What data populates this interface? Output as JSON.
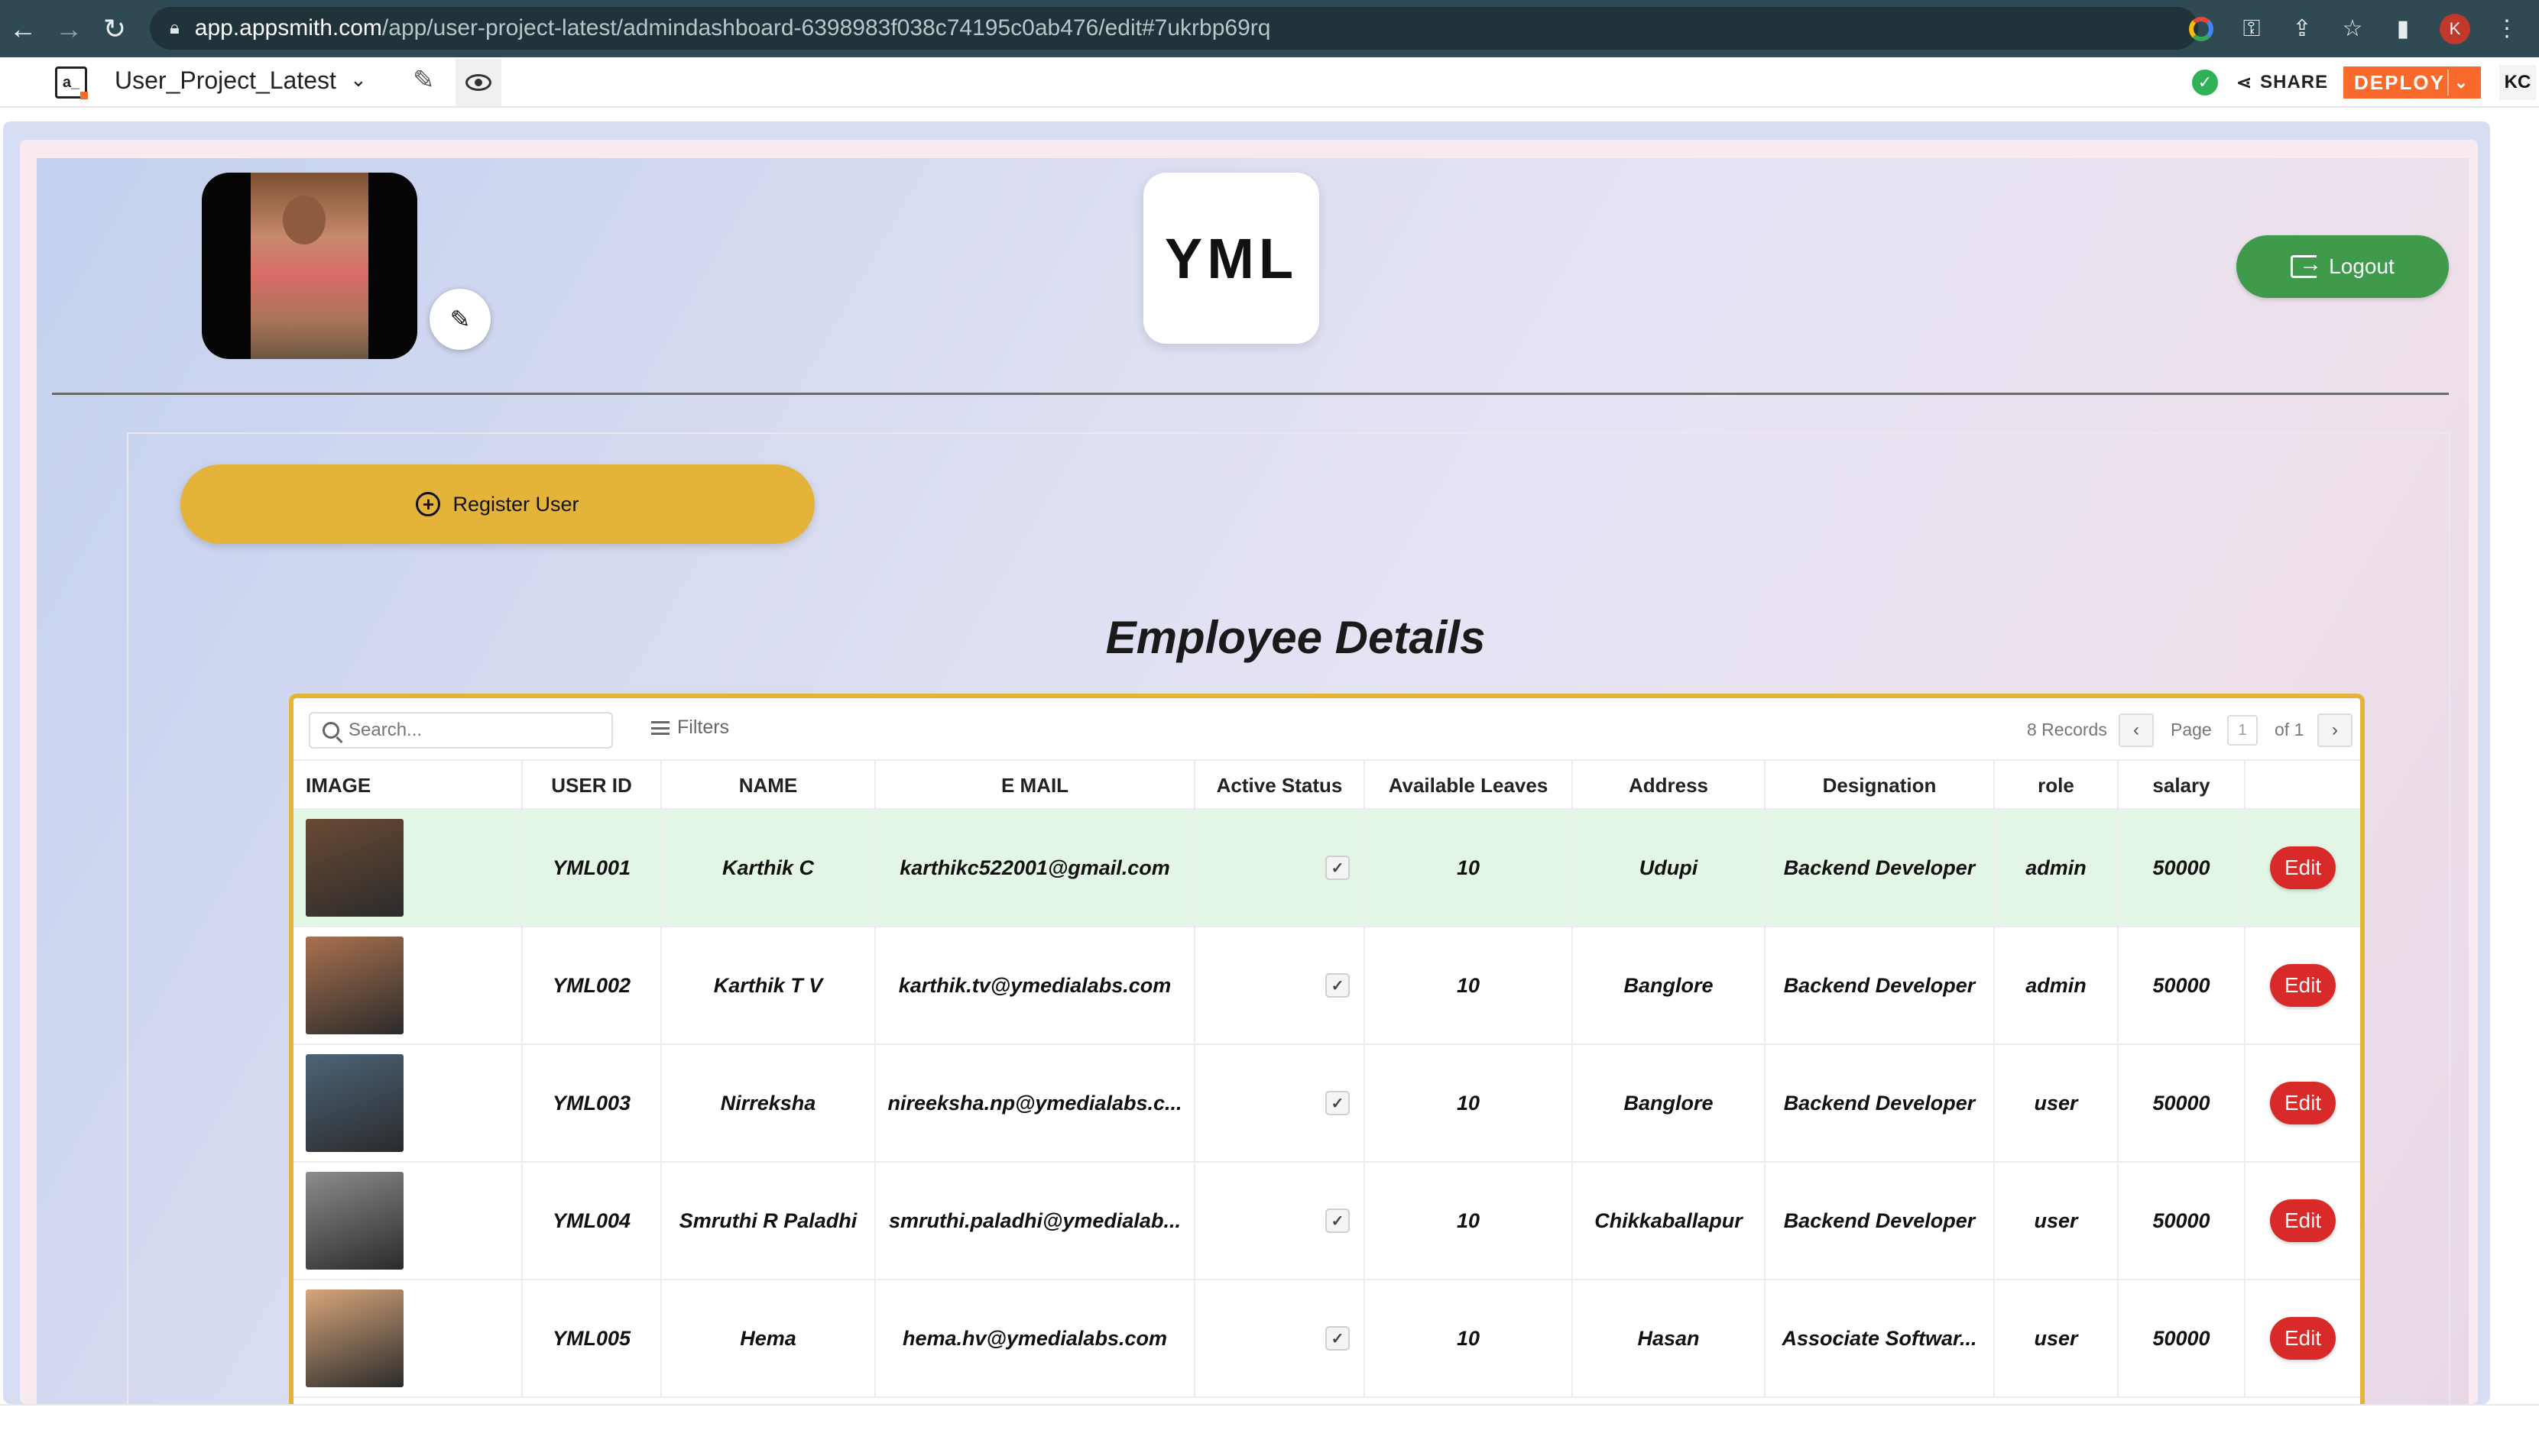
{
  "browser": {
    "url_host": "app.appsmith.com",
    "url_path": "/app/user-project-latest/admindashboard-6398983f038c74195c0ab476/edit#7ukrbp69rq",
    "profile_initial": "K"
  },
  "appbar": {
    "logo_text": "a_",
    "app_name": "User_Project_Latest",
    "share_label": "SHARE",
    "deploy_label": "DEPLOY",
    "user_initials": "KC"
  },
  "page": {
    "logo_text": "YML",
    "logout_label": "Logout",
    "register_label": "Register User",
    "title": "Employee Details"
  },
  "table": {
    "search_placeholder": "Search...",
    "filters_label": "Filters",
    "records_label": "8 Records",
    "page_label": "Page",
    "page_number": "1",
    "page_of": "of 1",
    "columns": [
      "IMAGE",
      "USER ID",
      "NAME",
      "E MAIL",
      "Active Status",
      "Available Leaves",
      "Address",
      "Designation",
      "role",
      "salary"
    ],
    "rows": [
      {
        "user_id": "YML001",
        "name": "Karthik C",
        "email": "karthikc522001@gmail.com",
        "active": true,
        "leaves": "10",
        "address": "Udupi",
        "designation": "Backend Developer",
        "role": "admin",
        "salary": "50000",
        "edit": "Edit",
        "thumb": "#6a4a34"
      },
      {
        "user_id": "YML002",
        "name": "Karthik T V",
        "email": "karthik.tv@ymedialabs.com",
        "active": true,
        "leaves": "10",
        "address": "Banglore",
        "designation": "Backend Developer",
        "role": "admin",
        "salary": "50000",
        "edit": "Edit",
        "thumb": "#a9714e"
      },
      {
        "user_id": "YML003",
        "name": "Nirreksha",
        "email": "nireeksha.np@ymedialabs.c...",
        "active": true,
        "leaves": "10",
        "address": "Banglore",
        "designation": "Backend Developer",
        "role": "user",
        "salary": "50000",
        "edit": "Edit",
        "thumb": "#4c6478"
      },
      {
        "user_id": "YML004",
        "name": "Smruthi R Paladhi",
        "email": "smruthi.paladhi@ymedialab...",
        "active": true,
        "leaves": "10",
        "address": "Chikkaballapur",
        "designation": "Backend Developer",
        "role": "user",
        "salary": "50000",
        "edit": "Edit",
        "thumb": "#8c8c8c"
      },
      {
        "user_id": "YML005",
        "name": "Hema",
        "email": "hema.hv@ymedialabs.com",
        "active": true,
        "leaves": "10",
        "address": "Hasan",
        "designation": "Associate Softwar...",
        "role": "user",
        "salary": "50000",
        "edit": "Edit",
        "thumb": "#d7a67a"
      }
    ]
  },
  "colors": {
    "chrome": "#2f4a52",
    "deploy": "#f86a2b",
    "logout": "#3f9a4c",
    "register": "#e4b33a",
    "table_border": "#e4b33a",
    "selected_row": "#e3f6e6",
    "edit_button": "#d92a2a"
  }
}
